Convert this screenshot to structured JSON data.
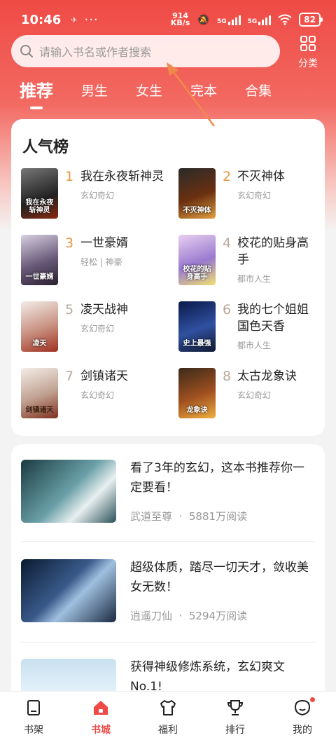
{
  "status_bar": {
    "time": "10:46",
    "net_speed_value": "914",
    "net_speed_unit": "KB/s",
    "net_5g_1": "5G",
    "net_5g_2": "5G",
    "battery": "82"
  },
  "search": {
    "placeholder": "请输入书名或作者搜索"
  },
  "category_button": {
    "label": "分类"
  },
  "tabs": [
    {
      "label": "推荐",
      "active": true
    },
    {
      "label": "男生",
      "active": false
    },
    {
      "label": "女生",
      "active": false
    },
    {
      "label": "完本",
      "active": false
    },
    {
      "label": "合集",
      "active": false
    }
  ],
  "ranking": {
    "title": "人气榜",
    "books": [
      {
        "rank": "1",
        "title": "我在永夜斩神灵",
        "tag": "玄幻奇幻",
        "cover_text": "我在永夜斩神灵",
        "rank_color": "#e7973f",
        "cover_color": "#3a3a3a"
      },
      {
        "rank": "2",
        "title": "不灭神体",
        "tag": "玄幻奇幻",
        "cover_text": "不灭神体",
        "rank_color": "#e7973f",
        "cover_color": "#4b2a1a"
      },
      {
        "rank": "3",
        "title": "一世豪婿",
        "tag": "轻松 | 神豪",
        "cover_text": "一世豪婿",
        "rank_color": "#e7973f",
        "cover_color": "#4a3a5a"
      },
      {
        "rank": "4",
        "title": "校花的贴身高手",
        "tag": "都市人生",
        "cover_text": "校花的贴身高手",
        "rank_color": "#b9a89a",
        "cover_color": "#8a6ab8"
      },
      {
        "rank": "5",
        "title": "凌天战神",
        "tag": "玄幻奇幻",
        "cover_text": "凌天",
        "rank_color": "#b9a89a",
        "cover_color": "#c9b8b0"
      },
      {
        "rank": "6",
        "title": "我的七个姐姐国色天香",
        "tag": "都市人生",
        "cover_text": "史上最强",
        "rank_color": "#b9a89a",
        "cover_color": "#1a2a5a"
      },
      {
        "rank": "7",
        "title": "剑镇诸天",
        "tag": "玄幻奇幻",
        "cover_text": "剑镇诸天",
        "rank_color": "#b9a89a",
        "cover_color": "#e8ddd5"
      },
      {
        "rank": "8",
        "title": "太古龙象诀",
        "tag": "玄幻奇幻",
        "cover_text": "龙象诀",
        "rank_color": "#b9a89a",
        "cover_color": "#5a3a20"
      }
    ]
  },
  "feed": [
    {
      "title": "看了3年的玄幻，这本书推荐你一定要看！",
      "book": "武道至尊",
      "reads": "5881万阅读",
      "dot": "·"
    },
    {
      "title": "超级体质，踏尽一切天才，敛收美女无数！",
      "book": "逍遥刀仙",
      "reads": "5294万阅读",
      "dot": "·"
    },
    {
      "title": "获得神级修炼系统，玄幻爽文No.1!",
      "book": "",
      "reads": "",
      "dot": ""
    }
  ],
  "bottom_nav": [
    {
      "label": "书架",
      "icon": "bookshelf-icon",
      "active": false
    },
    {
      "label": "书城",
      "icon": "bookstore-icon",
      "active": true
    },
    {
      "label": "福利",
      "icon": "gift-shirt-icon",
      "active": false
    },
    {
      "label": "排行",
      "icon": "trophy-icon",
      "active": false
    },
    {
      "label": "我的",
      "icon": "profile-icon",
      "active": false
    }
  ],
  "colors": {
    "brand_red": "#ef4a45",
    "annotation_arrow": "#f08a4b"
  }
}
